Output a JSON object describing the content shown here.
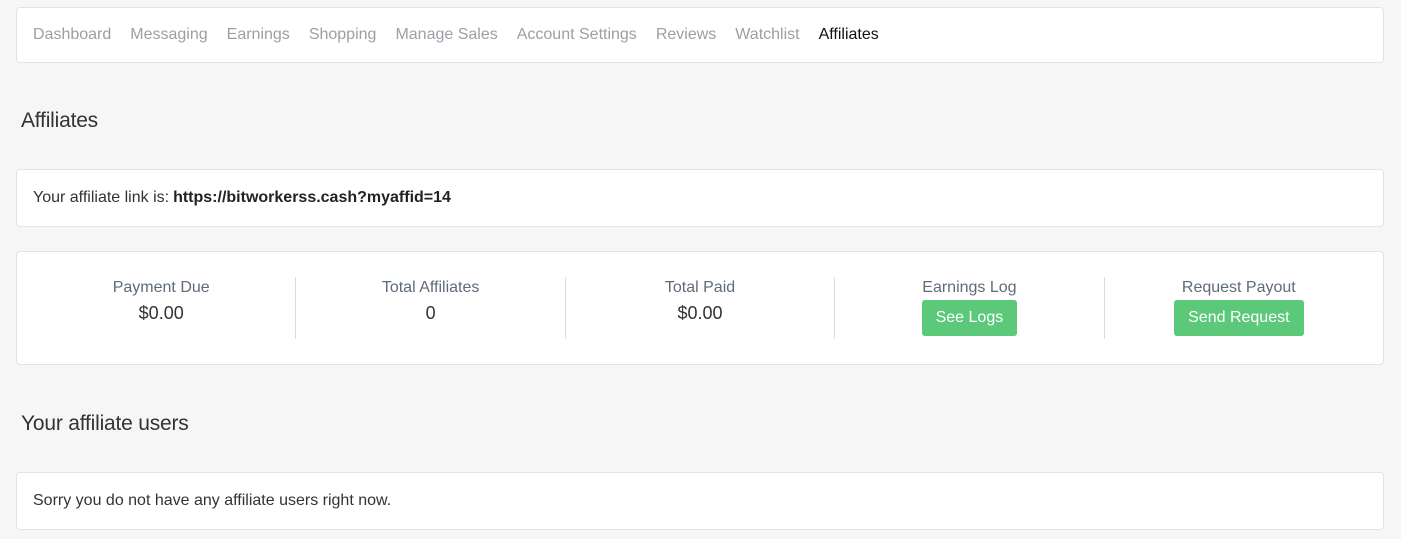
{
  "nav": {
    "items": [
      {
        "label": "Dashboard",
        "active": false
      },
      {
        "label": "Messaging",
        "active": false
      },
      {
        "label": "Earnings",
        "active": false
      },
      {
        "label": "Shopping",
        "active": false
      },
      {
        "label": "Manage Sales",
        "active": false
      },
      {
        "label": "Account Settings",
        "active": false
      },
      {
        "label": "Reviews",
        "active": false
      },
      {
        "label": "Watchlist",
        "active": false
      },
      {
        "label": "Affiliates",
        "active": true
      }
    ]
  },
  "page_title": "Affiliates",
  "affiliate_link": {
    "prefix": "Your affiliate link is:",
    "url": "https://bitworkerss.cash?myaffid=14"
  },
  "stats": {
    "payment_due": {
      "label": "Payment Due",
      "value": "$0.00"
    },
    "total_affiliates": {
      "label": "Total Affiliates",
      "value": "0"
    },
    "total_paid": {
      "label": "Total Paid",
      "value": "$0.00"
    },
    "earnings_log": {
      "label": "Earnings Log",
      "button": "See Logs"
    },
    "request_payout": {
      "label": "Request Payout",
      "button": "Send Request"
    }
  },
  "users_section": {
    "title": "Your affiliate users",
    "empty_message": "Sorry you do not have any affiliate users right now."
  },
  "colors": {
    "accent_button": "#5cc87a",
    "background": "#f6f6f6"
  }
}
